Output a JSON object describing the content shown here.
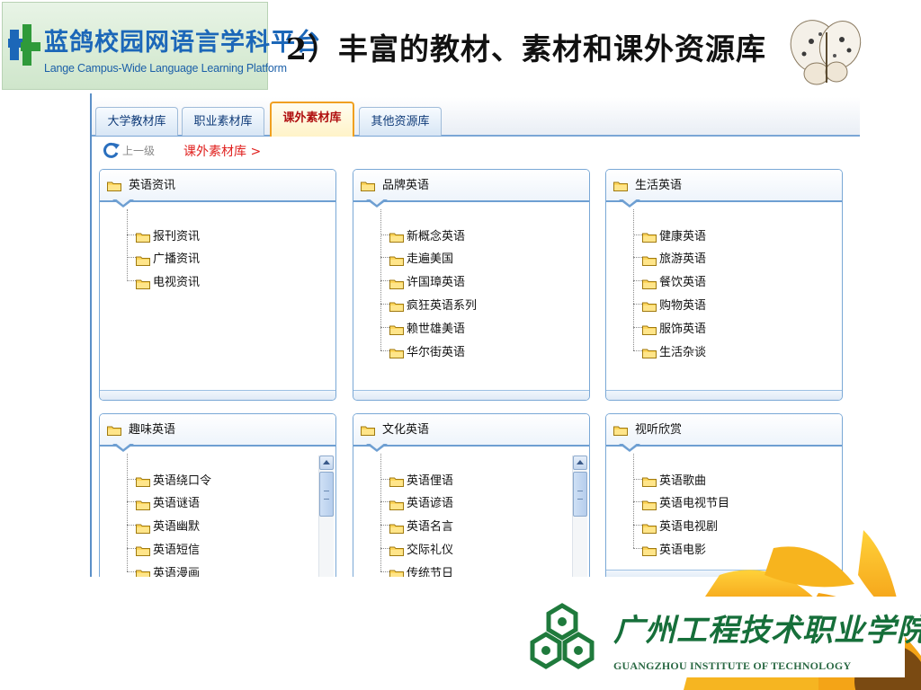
{
  "header": {
    "logo_cn": "蓝鸽校园网语言学科平台",
    "logo_en": "Lange Campus-Wide Language Learning Platform",
    "slide_title": "2）丰富的教材、素材和课外资源库"
  },
  "tabs": [
    {
      "label": "大学教材库",
      "active": false
    },
    {
      "label": "职业素材库",
      "active": false
    },
    {
      "label": "课外素材库",
      "active": true
    },
    {
      "label": "其他资源库",
      "active": false
    }
  ],
  "nav": {
    "back_label": "上一级",
    "breadcrumb": "课外素材库 >"
  },
  "panels": [
    {
      "title": "英语资讯",
      "items": [
        "报刊资讯",
        "广播资讯",
        "电视资讯"
      ],
      "scroll": false
    },
    {
      "title": "品牌英语",
      "items": [
        "新概念英语",
        "走遍美国",
        "许国璋英语",
        "疯狂英语系列",
        "赖世雄美语",
        "华尔街英语"
      ],
      "scroll": false
    },
    {
      "title": "生活英语",
      "items": [
        "健康英语",
        "旅游英语",
        "餐饮英语",
        "购物英语",
        "服饰英语",
        "生活杂谈"
      ],
      "scroll": false
    },
    {
      "title": "趣味英语",
      "items": [
        "英语绕口令",
        "英语谜语",
        "英语幽默",
        "英语短信",
        "英语漫画"
      ],
      "scroll": true
    },
    {
      "title": "文化英语",
      "items": [
        "英语俚语",
        "英语谚语",
        "英语名言",
        "交际礼仪",
        "传统节日"
      ],
      "scroll": true
    },
    {
      "title": "视听欣赏",
      "items": [
        "英语歌曲",
        "英语电视节目",
        "英语电视剧",
        "英语电影"
      ],
      "scroll": false
    }
  ],
  "footer": {
    "college_cn": "广州工程技术职业学院",
    "college_en": "GUANGZHOU INSTITUTE OF TECHNOLOGY"
  },
  "colors": {
    "accent_blue": "#1c67b8",
    "tab_active_border": "#f0a020",
    "breadcrumb_red": "#e0201e",
    "college_green": "#166f3a"
  },
  "icons": [
    "refresh-icon",
    "folder-icon",
    "scroll-up-icon",
    "butterfly-icon",
    "sunflower-icon",
    "college-emblem-icon"
  ]
}
